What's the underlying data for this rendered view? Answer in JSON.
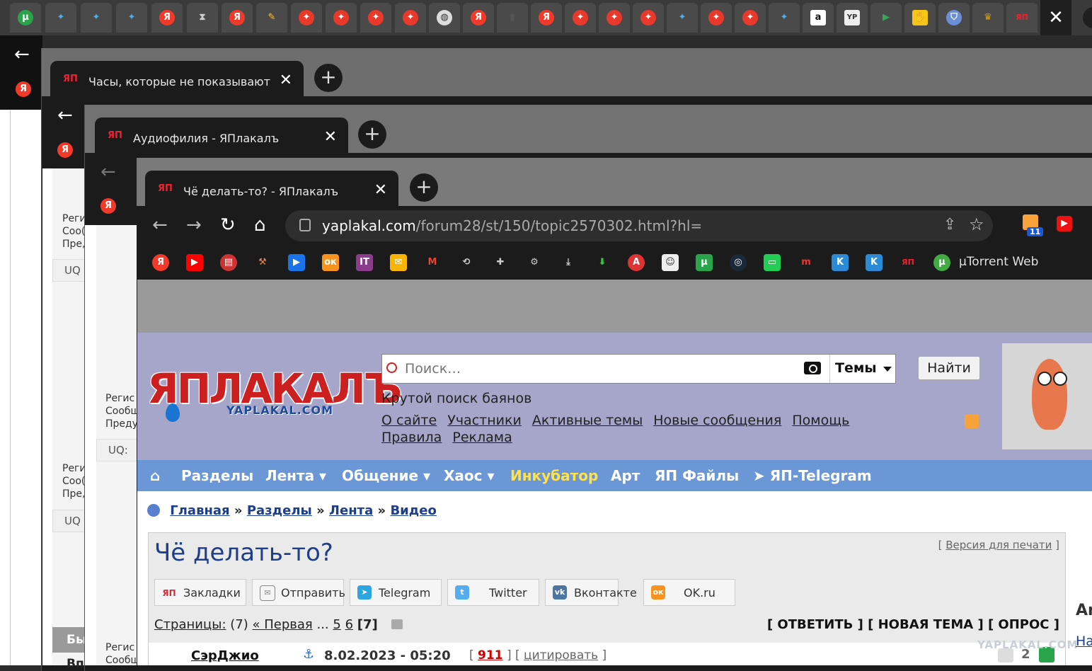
{
  "outer_tabs": {
    "close_label": "✕",
    "icons": [
      "torrent-icon",
      "bird-icon",
      "bird-icon",
      "bird-icon",
      "yandex-icon",
      "hourglass-icon",
      "yandex-icon",
      "pencil-icon",
      "star-icon",
      "star-icon",
      "star-icon",
      "star-icon",
      "globe-icon",
      "yandex-icon",
      "usb-icon",
      "yandex-icon",
      "star-icon",
      "star-icon",
      "star-icon",
      "bird-icon",
      "star-icon",
      "star-icon",
      "bird-icon",
      "amazon-icon",
      "yp-icon",
      "play-icon",
      "hand-icon",
      "shield-icon",
      "emblem-icon",
      "yap-icon"
    ]
  },
  "window_back": {
    "tab1_title": "Часы, которые не показывают в",
    "tab2_title": "Аудиофилия - ЯПлакалъ",
    "frag1": [
      "Реги",
      "Coo(",
      "Пре,"
    ],
    "frag2": [
      "Регис",
      "Сообщ",
      "Преду"
    ],
    "frag3": [
      "Реги",
      "Coo(",
      "Пре,"
    ],
    "frag4": [
      "Регис",
      "Сообщ"
    ],
    "uq1": "UQ",
    "uq2": "UQ:",
    "uq3": "UQ",
    "bottom1": "Бы",
    "bottom2": "Впо"
  },
  "browser": {
    "tab_title": "Чё делать-то? - ЯПлакалъ",
    "url_host": "yaplakal.com",
    "url_path": "/forum28/st/150/topic2570302.html?hl=",
    "rss_badge": "11",
    "bookmark_label": "µTorrent Web"
  },
  "header": {
    "logo_text": "ЯПЛАКАЛЪ",
    "logo_sub": "YAPLAKAL.COM",
    "search_placeholder": "Поиск…",
    "themes_label": "Темы",
    "find_button": "Найти",
    "tagline": "Крутой поиск баянов",
    "links": [
      "О сайте",
      "Участники",
      "Активные темы",
      "Новые сообщения",
      "Помощь",
      "Правила",
      "Реклама"
    ]
  },
  "menu": {
    "home": "⌂",
    "items": [
      "Разделы",
      "Лента ▾",
      "Общение ▾",
      "Хаос ▾",
      "Инкубатор",
      "Арт",
      "ЯП Файлы",
      "ЯП-Telegram"
    ]
  },
  "breadcrumbs": [
    "Главная",
    "Разделы",
    "Лента",
    "Видео"
  ],
  "breadcrumb_sep": "»",
  "topic": {
    "title": "Чё делать-то?",
    "print_label": "Версия для печати",
    "share": [
      "Закладки",
      "Отправить",
      "Telegram",
      "Twitter",
      "Вконтакте",
      "OK.ru"
    ],
    "pages_label": "Страницы:",
    "pages_count": "(7)",
    "first_label": "« Первая",
    "ellipsis": "...",
    "page5": "5",
    "page6": "6",
    "current": "[7]",
    "actions": "[ ОТВЕТИТЬ ] [ НОВАЯ ТЕМА ] [ ОПРОС ]"
  },
  "post": {
    "author": "СэрДжио",
    "date": "8.02.2023 - 05:20",
    "rating": "911",
    "quote_label": "цитировать",
    "votes": "2"
  },
  "watermark": "YAPLAKAL.COM",
  "right_fragment": {
    "title": "Ar",
    "link": "На"
  }
}
